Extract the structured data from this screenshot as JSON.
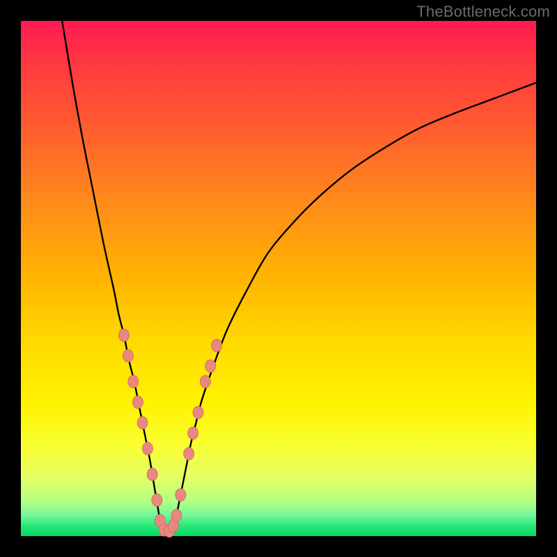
{
  "watermark": "TheBottleneck.com",
  "colors": {
    "frame": "#000000",
    "curve_stroke": "#000000",
    "marker_fill": "#e98880",
    "marker_stroke": "#c86a62"
  },
  "chart_data": {
    "type": "line",
    "title": "",
    "xlabel": "",
    "ylabel": "",
    "xlim": [
      0,
      100
    ],
    "ylim": [
      0,
      100
    ],
    "grid": false,
    "series": [
      {
        "name": "left-branch",
        "x": [
          8,
          10,
          12,
          14,
          16,
          18,
          19,
          20,
          21,
          22,
          23,
          24,
          25,
          26,
          27
        ],
        "y": [
          100,
          88,
          77,
          67,
          57,
          48,
          43,
          39,
          34,
          30,
          25,
          20,
          15,
          9,
          3
        ]
      },
      {
        "name": "right-branch",
        "x": [
          30,
          31,
          32,
          33,
          34,
          35,
          37,
          40,
          44,
          48,
          53,
          58,
          64,
          70,
          77,
          84,
          92,
          100
        ],
        "y": [
          3,
          8,
          13,
          18,
          22,
          26,
          32,
          40,
          48,
          55,
          61,
          66,
          71,
          75,
          79,
          82,
          85,
          88
        ]
      },
      {
        "name": "bottom-segment",
        "x": [
          27,
          28,
          29,
          30
        ],
        "y": [
          3,
          1,
          1,
          3
        ]
      }
    ],
    "markers": [
      {
        "x": 20.0,
        "y": 39
      },
      {
        "x": 20.8,
        "y": 35
      },
      {
        "x": 21.8,
        "y": 30
      },
      {
        "x": 22.7,
        "y": 26
      },
      {
        "x": 23.6,
        "y": 22
      },
      {
        "x": 24.6,
        "y": 17
      },
      {
        "x": 25.5,
        "y": 12
      },
      {
        "x": 26.4,
        "y": 7
      },
      {
        "x": 27.0,
        "y": 3
      },
      {
        "x": 27.8,
        "y": 1.2
      },
      {
        "x": 28.8,
        "y": 1.0
      },
      {
        "x": 29.6,
        "y": 2.0
      },
      {
        "x": 30.2,
        "y": 4
      },
      {
        "x": 31.0,
        "y": 8
      },
      {
        "x": 32.6,
        "y": 16
      },
      {
        "x": 33.4,
        "y": 20
      },
      {
        "x": 34.4,
        "y": 24
      },
      {
        "x": 35.8,
        "y": 30
      },
      {
        "x": 36.8,
        "y": 33
      },
      {
        "x": 38.0,
        "y": 37
      }
    ]
  }
}
